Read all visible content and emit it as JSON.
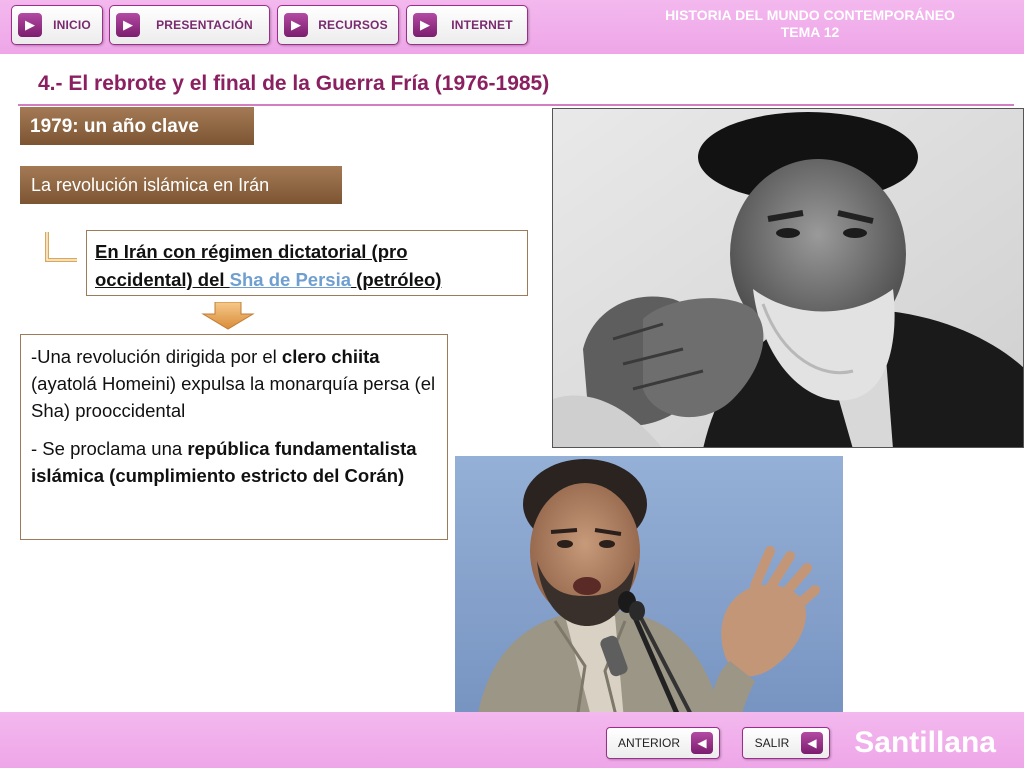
{
  "nav": {
    "inicio": "INICIO",
    "presentacion": "PRESENTACIÓN",
    "recursos": "RECURSOS",
    "internet": "INTERNET"
  },
  "course": {
    "line1": "HISTORIA DEL MUNDO CONTEMPORÁNEO",
    "line2": "TEMA 12"
  },
  "page_title": "4.- El rebrote y el final de la Guerra Fría (1976-1985)",
  "year_label": "1979: un año clave",
  "topic_label": "La revolución islámica en Irán",
  "iran_box": {
    "line1": "En Irán con régimen dictatorial (pro",
    "line2_pre": "occidental) del ",
    "link": "Sha de Persia",
    "line2_post": " (petróleo)"
  },
  "main_box": {
    "p1_a": "-Una revolución dirigida por el ",
    "p1_b": "clero chiita",
    "p1_c": " (ayatolá Homeini) expulsa la monarquía persa (el Sha) prooccidental",
    "p2_a": "- Se proclama una ",
    "p2_b": "república fundamentalista islámica (cumplimiento estricto del Corán)"
  },
  "footer": {
    "anterior": "ANTERIOR",
    "salir": "SALIR",
    "brand": "Santillana"
  },
  "icons": {
    "nav_arrow": "play-right-icon",
    "footer_arrow": "play-left-icon"
  },
  "colors": {
    "bar_pink": "#eea6e8",
    "accent_purple": "#8a2060",
    "label_brown": "#7c5533",
    "link_blue": "#6f9fd0"
  }
}
